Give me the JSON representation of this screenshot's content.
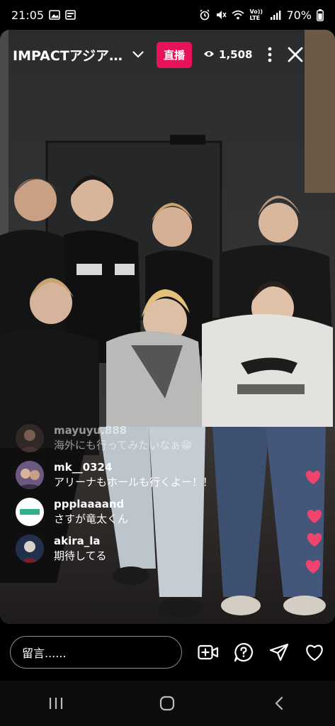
{
  "status_bar": {
    "time": "21:05",
    "battery": "70%",
    "network": "Vo)) LTE"
  },
  "live": {
    "title": "IMPACTアジア…",
    "live_label": "直播",
    "viewer_count": "1,508"
  },
  "comments": [
    {
      "user": "mayuyu.888",
      "text": "海外にも行ってみたいなぁ😁",
      "avatar_color": "#4a3a36"
    },
    {
      "user": "mk__0324",
      "text": "アリーナもホールも行くよー！！",
      "avatar_color": "#5a4a6a"
    },
    {
      "user": "ppplaaaand",
      "text": "さすが竜太くん",
      "avatar_color": "#ffffff"
    },
    {
      "user": "akira_la",
      "text": "期待してる",
      "avatar_color": "#2a3550"
    }
  ],
  "input": {
    "placeholder": "留言......"
  },
  "colors": {
    "live_badge": "#e8115b",
    "heart": "#f0446e"
  },
  "icons": {
    "bottom": [
      "add-guest-icon",
      "question-icon",
      "share-icon",
      "like-icon"
    ],
    "nav": [
      "recent-apps-icon",
      "home-icon",
      "back-icon"
    ]
  }
}
